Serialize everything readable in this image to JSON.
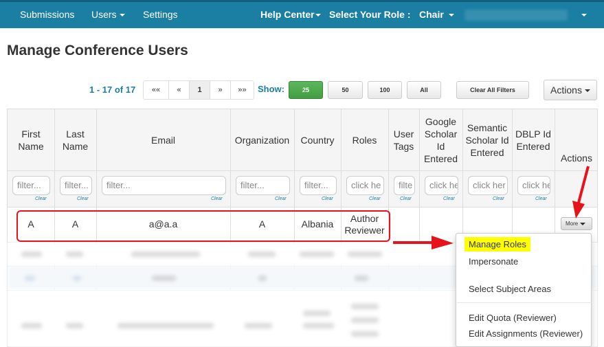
{
  "nav": {
    "submissions": "Submissions",
    "users": "Users",
    "settings": "Settings",
    "help_center": "Help Center",
    "select_role_label": "Select Your Role :",
    "role": "Chair"
  },
  "page_title": "Manage Conference Users",
  "pagination": {
    "count": "1 - 17 of 17",
    "first": "««",
    "prev": "«",
    "page": "1",
    "next": "»",
    "last": "»»"
  },
  "show": {
    "label": "Show:",
    "options": [
      "25",
      "50",
      "100",
      "All"
    ]
  },
  "toolbar": {
    "clear_filters": "Clear All Filters",
    "actions": "Actions"
  },
  "columns": [
    "First Name",
    "Last Name",
    "Email",
    "Organization",
    "Country",
    "Roles",
    "User Tags",
    "Google Scholar Id Entered",
    "Semantic Scholar Id Entered",
    "DBLP Id Entered",
    "Actions"
  ],
  "filters": {
    "first_name": "filter...",
    "last_name": "filter...",
    "email": "filter...",
    "organization": "filter...",
    "country": "filter...",
    "roles": "click he",
    "user_tags": "filte",
    "google": "click he",
    "semantic": "click her",
    "dblp": "click he",
    "clear": "Clear"
  },
  "row": {
    "first_name": "A",
    "last_name": "A",
    "email": "a@a.a",
    "organization": "A",
    "country": "Albania",
    "roles_line1": "Author",
    "roles_line2": "Reviewer",
    "more": "More"
  },
  "menu": {
    "manage_roles": "Manage Roles",
    "impersonate": "Impersonate",
    "select_subject_areas": "Select Subject Areas",
    "edit_quota": "Edit Quota (Reviewer)",
    "edit_assignments": "Edit Assignments (Reviewer)"
  },
  "colors": {
    "navbar": "#1a7fa3",
    "accent": "#1a7fa3",
    "highlight_red": "#e8121b",
    "highlight_yellow": "#ffff00",
    "show_active": "#5cb85c"
  }
}
